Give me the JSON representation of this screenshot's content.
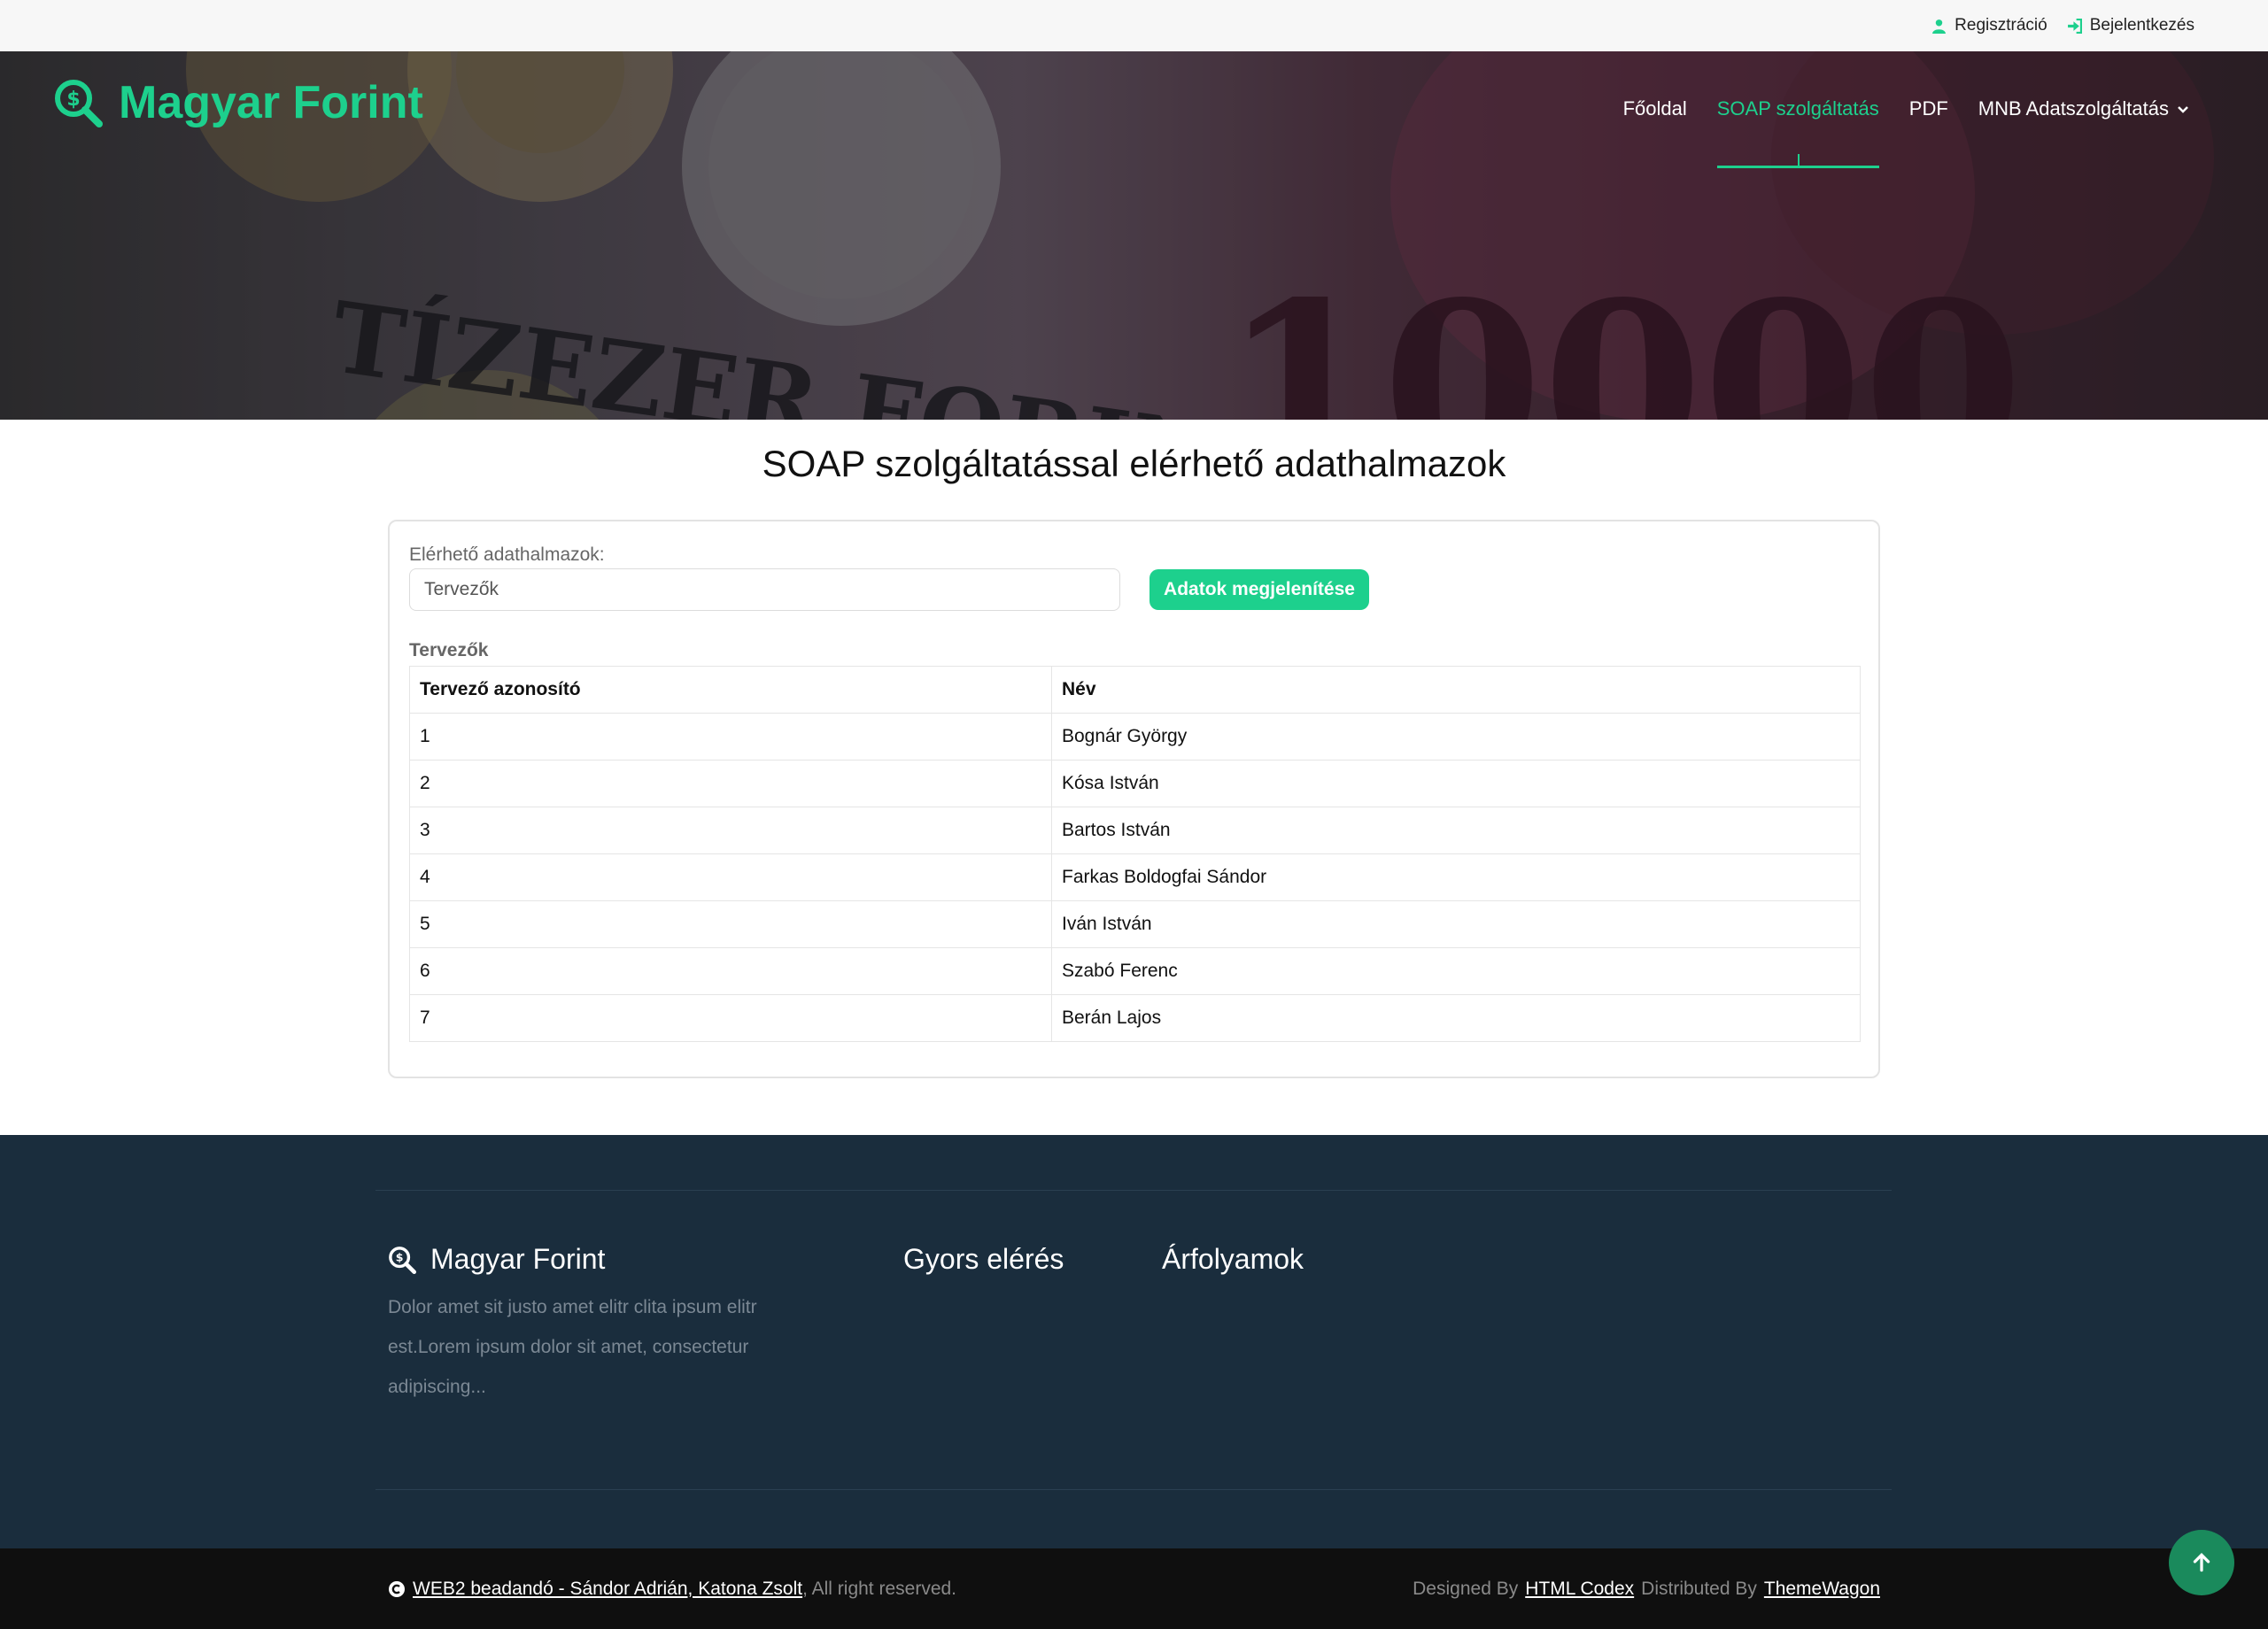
{
  "topbar": {
    "register_label": "Regisztráció",
    "login_label": "Bejelentkezés"
  },
  "header": {
    "brand": "Magyar Forint",
    "nav": {
      "home": "Főoldal",
      "soap": "SOAP szolgáltatás",
      "pdf": "PDF",
      "mnb": "MNB Adatszolgáltatás"
    }
  },
  "main": {
    "title": "SOAP szolgáltatással elérhető adathalmazok",
    "select_label": "Elérhető adathalmazok:",
    "select_value": "Tervezők",
    "show_button": "Adatok megjelenítése",
    "table_caption": "Tervezők",
    "table": {
      "headers": [
        "Tervező azonosító",
        "Név"
      ],
      "rows": [
        [
          "1",
          "Bognár György"
        ],
        [
          "2",
          "Kósa István"
        ],
        [
          "3",
          "Bartos István"
        ],
        [
          "4",
          "Farkas Boldogfai Sándor"
        ],
        [
          "5",
          "Iván István"
        ],
        [
          "6",
          "Szabó Ferenc"
        ],
        [
          "7",
          "Berán Lajos"
        ]
      ]
    }
  },
  "footer": {
    "brand": "Magyar Forint",
    "description": "Dolor amet sit justo amet elitr clita ipsum elitr est.Lorem ipsum dolor sit amet, consectetur adipiscing...",
    "quick_links_title": "Gyors elérés",
    "rates_title": "Árfolyamok",
    "copyright_link": "WEB2 beadandó - Sándor Adrián, Katona Zsolt",
    "copyright_suffix": ", All right reserved.",
    "designed_by": "Designed By",
    "designer": "HTML Codex",
    "distributed_by": "Distributed By",
    "distributor": "ThemeWagon"
  },
  "colors": {
    "accent": "#1dd08d",
    "footer_bg": "#1a2d3d",
    "bottom_bar": "#0f0f0f"
  },
  "icons": [
    "user-icon",
    "sign-in-icon",
    "search-dollar-icon",
    "chevron-down-icon",
    "copyright-icon",
    "arrow-up-icon"
  ]
}
